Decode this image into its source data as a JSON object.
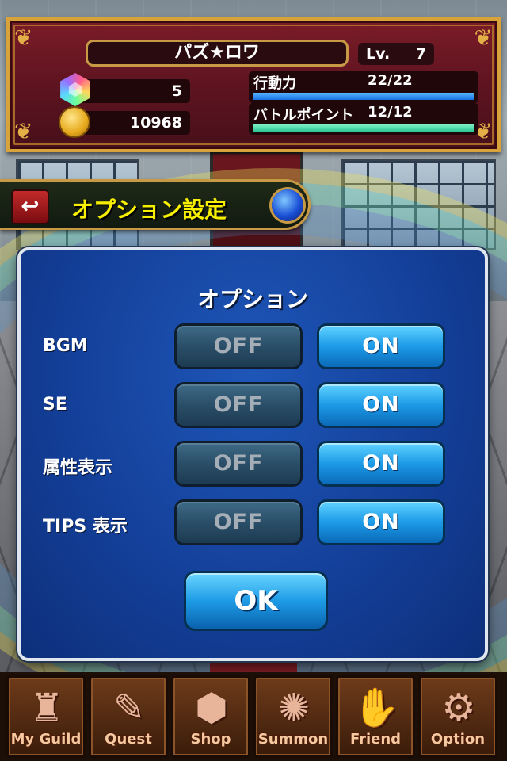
{
  "player": {
    "name": "パズ★ロワ",
    "level_label": "Lv.",
    "level": "7",
    "magic_stones": "5",
    "coins": "10968"
  },
  "stamina": {
    "label": "行動力",
    "value": "22/22",
    "fill": 1.0
  },
  "battle_points": {
    "label": "バトルポイント",
    "value": "12/12",
    "fill": 1.0
  },
  "screen_title": "オプション設定",
  "dialog": {
    "title": "オプション",
    "rows": [
      {
        "label": "BGM",
        "off": "OFF",
        "on": "ON",
        "selected": "ON"
      },
      {
        "label": "SE",
        "off": "OFF",
        "on": "ON",
        "selected": "ON"
      },
      {
        "label": "属性表示",
        "off": "OFF",
        "on": "ON",
        "selected": "ON"
      },
      {
        "label": "TIPS 表示",
        "off": "OFF",
        "on": "ON",
        "selected": "ON"
      }
    ],
    "ok": "OK"
  },
  "nav": [
    {
      "label": "My Guild",
      "icon": "castle-icon"
    },
    {
      "label": "Quest",
      "icon": "map-quill-icon"
    },
    {
      "label": "Shop",
      "icon": "stones-icon"
    },
    {
      "label": "Summon",
      "icon": "magic-circle-icon"
    },
    {
      "label": "Friend",
      "icon": "handshake-icon"
    },
    {
      "label": "Option",
      "icon": "gear-icon"
    }
  ],
  "colors": {
    "header_bg": "#5e1420",
    "frame_gold": "#d9a33b",
    "title_yellow": "#f6f000",
    "dialog_blue": "#14409a",
    "on_button": "#1c9ae6",
    "off_button": "#2a4e68",
    "stamina_bar": "#1670e0",
    "bp_bar": "#2bc496"
  }
}
